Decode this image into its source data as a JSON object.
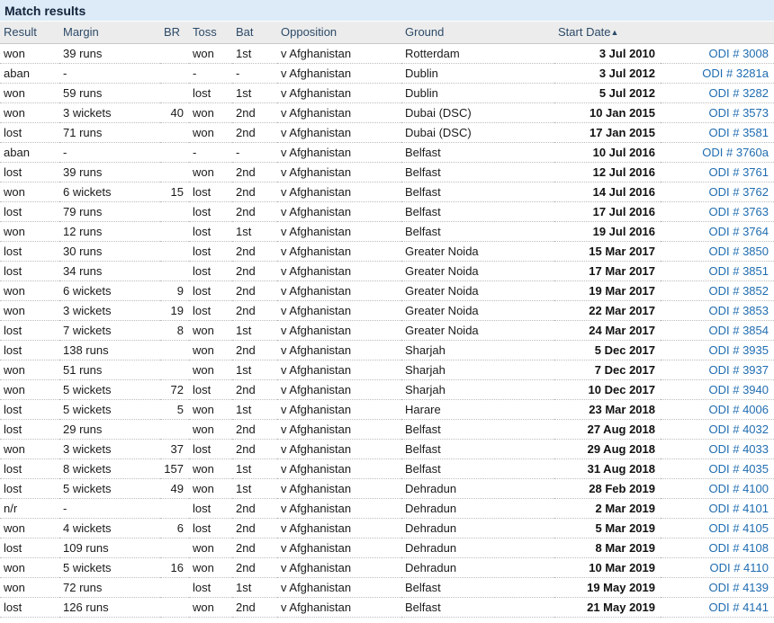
{
  "panel": {
    "title": "Match results"
  },
  "table": {
    "columns": [
      {
        "key": "result",
        "label": "Result"
      },
      {
        "key": "margin",
        "label": "Margin"
      },
      {
        "key": "br",
        "label": "BR"
      },
      {
        "key": "toss",
        "label": "Toss"
      },
      {
        "key": "bat",
        "label": "Bat"
      },
      {
        "key": "opposition",
        "label": "Opposition"
      },
      {
        "key": "ground",
        "label": "Ground"
      },
      {
        "key": "start_date",
        "label": "Start Date",
        "sorted": "asc",
        "sort_glyph": "▲"
      },
      {
        "key": "link",
        "label": ""
      }
    ],
    "rows": [
      {
        "result": "won",
        "margin": "39 runs",
        "br": "",
        "toss": "won",
        "bat": "1st",
        "opposition": "v Afghanistan",
        "ground": "Rotterdam",
        "start_date": "3 Jul 2010",
        "link": "ODI # 3008"
      },
      {
        "result": "aban",
        "margin": "-",
        "br": "",
        "toss": "-",
        "bat": "-",
        "opposition": "v Afghanistan",
        "ground": "Dublin",
        "start_date": "3 Jul 2012",
        "link": "ODI # 3281a"
      },
      {
        "result": "won",
        "margin": "59 runs",
        "br": "",
        "toss": "lost",
        "bat": "1st",
        "opposition": "v Afghanistan",
        "ground": "Dublin",
        "start_date": "5 Jul 2012",
        "link": "ODI # 3282"
      },
      {
        "result": "won",
        "margin": "3 wickets",
        "br": "40",
        "toss": "won",
        "bat": "2nd",
        "opposition": "v Afghanistan",
        "ground": "Dubai (DSC)",
        "start_date": "10 Jan 2015",
        "link": "ODI # 3573"
      },
      {
        "result": "lost",
        "margin": "71 runs",
        "br": "",
        "toss": "won",
        "bat": "2nd",
        "opposition": "v Afghanistan",
        "ground": "Dubai (DSC)",
        "start_date": "17 Jan 2015",
        "link": "ODI # 3581"
      },
      {
        "result": "aban",
        "margin": "-",
        "br": "",
        "toss": "-",
        "bat": "-",
        "opposition": "v Afghanistan",
        "ground": "Belfast",
        "start_date": "10 Jul 2016",
        "link": "ODI # 3760a"
      },
      {
        "result": "lost",
        "margin": "39 runs",
        "br": "",
        "toss": "won",
        "bat": "2nd",
        "opposition": "v Afghanistan",
        "ground": "Belfast",
        "start_date": "12 Jul 2016",
        "link": "ODI # 3761"
      },
      {
        "result": "won",
        "margin": "6 wickets",
        "br": "15",
        "toss": "lost",
        "bat": "2nd",
        "opposition": "v Afghanistan",
        "ground": "Belfast",
        "start_date": "14 Jul 2016",
        "link": "ODI # 3762"
      },
      {
        "result": "lost",
        "margin": "79 runs",
        "br": "",
        "toss": "lost",
        "bat": "2nd",
        "opposition": "v Afghanistan",
        "ground": "Belfast",
        "start_date": "17 Jul 2016",
        "link": "ODI # 3763"
      },
      {
        "result": "won",
        "margin": "12 runs",
        "br": "",
        "toss": "lost",
        "bat": "1st",
        "opposition": "v Afghanistan",
        "ground": "Belfast",
        "start_date": "19 Jul 2016",
        "link": "ODI # 3764"
      },
      {
        "result": "lost",
        "margin": "30 runs",
        "br": "",
        "toss": "lost",
        "bat": "2nd",
        "opposition": "v Afghanistan",
        "ground": "Greater Noida",
        "start_date": "15 Mar 2017",
        "link": "ODI # 3850"
      },
      {
        "result": "lost",
        "margin": "34 runs",
        "br": "",
        "toss": "lost",
        "bat": "2nd",
        "opposition": "v Afghanistan",
        "ground": "Greater Noida",
        "start_date": "17 Mar 2017",
        "link": "ODI # 3851"
      },
      {
        "result": "won",
        "margin": "6 wickets",
        "br": "9",
        "toss": "lost",
        "bat": "2nd",
        "opposition": "v Afghanistan",
        "ground": "Greater Noida",
        "start_date": "19 Mar 2017",
        "link": "ODI # 3852"
      },
      {
        "result": "won",
        "margin": "3 wickets",
        "br": "19",
        "toss": "lost",
        "bat": "2nd",
        "opposition": "v Afghanistan",
        "ground": "Greater Noida",
        "start_date": "22 Mar 2017",
        "link": "ODI # 3853"
      },
      {
        "result": "lost",
        "margin": "7 wickets",
        "br": "8",
        "toss": "won",
        "bat": "1st",
        "opposition": "v Afghanistan",
        "ground": "Greater Noida",
        "start_date": "24 Mar 2017",
        "link": "ODI # 3854"
      },
      {
        "result": "lost",
        "margin": "138 runs",
        "br": "",
        "toss": "won",
        "bat": "2nd",
        "opposition": "v Afghanistan",
        "ground": "Sharjah",
        "start_date": "5 Dec 2017",
        "link": "ODI # 3935"
      },
      {
        "result": "won",
        "margin": "51 runs",
        "br": "",
        "toss": "won",
        "bat": "1st",
        "opposition": "v Afghanistan",
        "ground": "Sharjah",
        "start_date": "7 Dec 2017",
        "link": "ODI # 3937"
      },
      {
        "result": "won",
        "margin": "5 wickets",
        "br": "72",
        "toss": "lost",
        "bat": "2nd",
        "opposition": "v Afghanistan",
        "ground": "Sharjah",
        "start_date": "10 Dec 2017",
        "link": "ODI # 3940"
      },
      {
        "result": "lost",
        "margin": "5 wickets",
        "br": "5",
        "toss": "won",
        "bat": "1st",
        "opposition": "v Afghanistan",
        "ground": "Harare",
        "start_date": "23 Mar 2018",
        "link": "ODI # 4006"
      },
      {
        "result": "lost",
        "margin": "29 runs",
        "br": "",
        "toss": "won",
        "bat": "2nd",
        "opposition": "v Afghanistan",
        "ground": "Belfast",
        "start_date": "27 Aug 2018",
        "link": "ODI # 4032"
      },
      {
        "result": "won",
        "margin": "3 wickets",
        "br": "37",
        "toss": "lost",
        "bat": "2nd",
        "opposition": "v Afghanistan",
        "ground": "Belfast",
        "start_date": "29 Aug 2018",
        "link": "ODI # 4033"
      },
      {
        "result": "lost",
        "margin": "8 wickets",
        "br": "157",
        "toss": "won",
        "bat": "1st",
        "opposition": "v Afghanistan",
        "ground": "Belfast",
        "start_date": "31 Aug 2018",
        "link": "ODI # 4035"
      },
      {
        "result": "lost",
        "margin": "5 wickets",
        "br": "49",
        "toss": "won",
        "bat": "1st",
        "opposition": "v Afghanistan",
        "ground": "Dehradun",
        "start_date": "28 Feb 2019",
        "link": "ODI # 4100"
      },
      {
        "result": "n/r",
        "margin": "-",
        "br": "",
        "toss": "lost",
        "bat": "2nd",
        "opposition": "v Afghanistan",
        "ground": "Dehradun",
        "start_date": "2 Mar 2019",
        "link": "ODI # 4101"
      },
      {
        "result": "won",
        "margin": "4 wickets",
        "br": "6",
        "toss": "lost",
        "bat": "2nd",
        "opposition": "v Afghanistan",
        "ground": "Dehradun",
        "start_date": "5 Mar 2019",
        "link": "ODI # 4105"
      },
      {
        "result": "lost",
        "margin": "109 runs",
        "br": "",
        "toss": "won",
        "bat": "2nd",
        "opposition": "v Afghanistan",
        "ground": "Dehradun",
        "start_date": "8 Mar 2019",
        "link": "ODI # 4108"
      },
      {
        "result": "won",
        "margin": "5 wickets",
        "br": "16",
        "toss": "won",
        "bat": "2nd",
        "opposition": "v Afghanistan",
        "ground": "Dehradun",
        "start_date": "10 Mar 2019",
        "link": "ODI # 4110"
      },
      {
        "result": "won",
        "margin": "72 runs",
        "br": "",
        "toss": "lost",
        "bat": "1st",
        "opposition": "v Afghanistan",
        "ground": "Belfast",
        "start_date": "19 May 2019",
        "link": "ODI # 4139"
      },
      {
        "result": "lost",
        "margin": "126 runs",
        "br": "",
        "toss": "won",
        "bat": "2nd",
        "opposition": "v Afghanistan",
        "ground": "Belfast",
        "start_date": "21 May 2019",
        "link": "ODI # 4141"
      }
    ]
  },
  "colors": {
    "title_bar_bg": "#dcebf7",
    "header_bg": "#ececec",
    "header_text": "#2c4a68",
    "link": "#1f6cb0",
    "row_border": "#bdbdbd"
  }
}
